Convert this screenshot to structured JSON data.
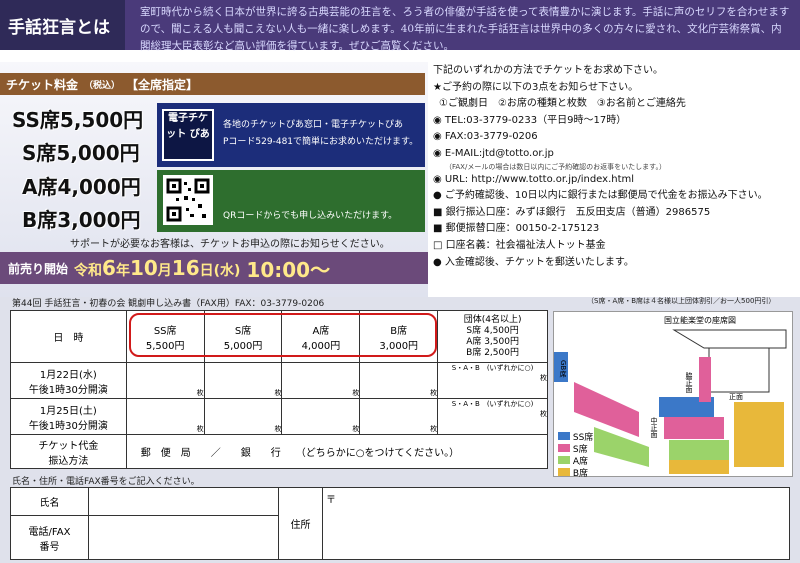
{
  "header": {
    "title": "手話狂言とは",
    "description": "室町時代から続く日本が世界に誇る古典芸能の狂言を、ろう者の俳優が手話を使って表情豊かに演じます。手話に声のセリフを合わせますので、聞こえる人も聞こえない人も一緒に楽しめます。40年前に生まれた手話狂言は世界中の多くの方々に愛され、文化庁芸術祭賞、内閣総理大臣表彰など高い評価を得ています。ぜひご高覧ください。"
  },
  "tickets": {
    "header_label": "チケット料金",
    "tax_note": "（税込）",
    "seat_note": "【全席指定】",
    "prices": [
      {
        "seat": "SS席",
        "price": "5,500円"
      },
      {
        "seat": "S席",
        "price": "5,000円"
      },
      {
        "seat": "A席",
        "price": "4,000円"
      },
      {
        "seat": "B席",
        "price": "3,000円"
      }
    ],
    "pia_logo": "電子チケット ぴあ",
    "pia_text_line1": "各地のチケットぴあ窓口・電子チケットぴあ",
    "pia_text_line2": "Pコード529-481で簡単にお求めいただけます。",
    "qr_text": "QRコードからでも申し込みいただけます。",
    "support_text": "サポートが必要なお客様は、チケットお申込の際にお知らせください。"
  },
  "presale": {
    "label": "前売り開始",
    "era": "令和",
    "year": "6",
    "year_unit": "年",
    "month": "10",
    "month_unit": "月",
    "day": "16",
    "day_unit": "日",
    "weekday": "(水)",
    "time": "10:00〜"
  },
  "order_info": {
    "intro1": "下記のいずれかの方法でチケットをお求め下さい。",
    "intro2": "★ご予約の際に以下の3点をお知らせ下さい。",
    "points": "①ご観劇日　②お席の種類と枚数　③お名前とご連絡先",
    "tel": "TEL:03-3779-0233（平日9時〜17時）",
    "fax": "FAX:03-3779-0206",
    "email": "E-MAIL:jtd@totto.or.jp",
    "email_note": "（FAX/メールの場合は数日以内にご予約確認のお返事をいたします。）",
    "url": "URL: http://www.totto.or.jp/index.html",
    "payment": "ご予約確認後、10日以内に銀行または郵便局で代金をお振込み下さい。",
    "bank": "銀行振込口座：みずほ銀行　五反田支店（普通）2986575",
    "postal": "郵便振替口座：00150-2-175123",
    "account_name": "口座名義：社会福祉法人トット基金",
    "confirm": "入金確認後、チケットを郵送いたします。"
  },
  "form": {
    "title": "第44回 手話狂言・初春の会 観劇申し込み書（FAX用）FAX：03-3779-0206",
    "group_note": "（S席・A席・B席は４名様以上団体割引／お一人500円引）",
    "date_header": "日　時",
    "seat_columns": [
      {
        "seat": "SS席",
        "price": "5,500円"
      },
      {
        "seat": "S席",
        "price": "5,000円"
      },
      {
        "seat": "A席",
        "price": "4,000円"
      },
      {
        "seat": "B席",
        "price": "3,000円"
      }
    ],
    "group_header": "団体(4名以上)",
    "group_prices": [
      "S席 4,500円",
      "A席 3,500円",
      "B席 2,500円"
    ],
    "performances": [
      {
        "date": "1月22日(水)",
        "time": "午後1時30分開演"
      },
      {
        "date": "1月25日(土)",
        "time": "午後1時30分開演"
      }
    ],
    "count_unit": "枚",
    "group_choice": "S・A・B　(いずれかに○)",
    "payment_label1": "チケット代金",
    "payment_label2": "振込方法",
    "payment_options": "郵　便　局　　／　　銀　　行",
    "payment_instruction": "（どちらかに○をつけてください。）",
    "personal_caption": "氏名・住所・電話FAX番号をご記入ください。",
    "name_label": "氏名",
    "phone_label1": "電話/FAX",
    "phone_label2": "番号",
    "address_label": "住所",
    "postal_mark": "〒"
  },
  "seat_map": {
    "title": "国立能楽堂の座席図",
    "legend": [
      {
        "label": "SS席",
        "color": "#3b78c8"
      },
      {
        "label": "S席",
        "color": "#e0609a"
      },
      {
        "label": "A席",
        "color": "#9bd36a"
      },
      {
        "label": "B席",
        "color": "#e8b83a"
      }
    ],
    "side_labels": [
      "GB席",
      "脇正面",
      "正面",
      "中正面"
    ]
  },
  "colors": {
    "header_bg": "#4a3a7a",
    "price_bar": "#8c5a2e",
    "pia_blue": "#1c2d7a",
    "qr_green": "#2e6e2e",
    "presale_bar": "#6b4a7a",
    "highlight_red": "#d11a1a"
  }
}
